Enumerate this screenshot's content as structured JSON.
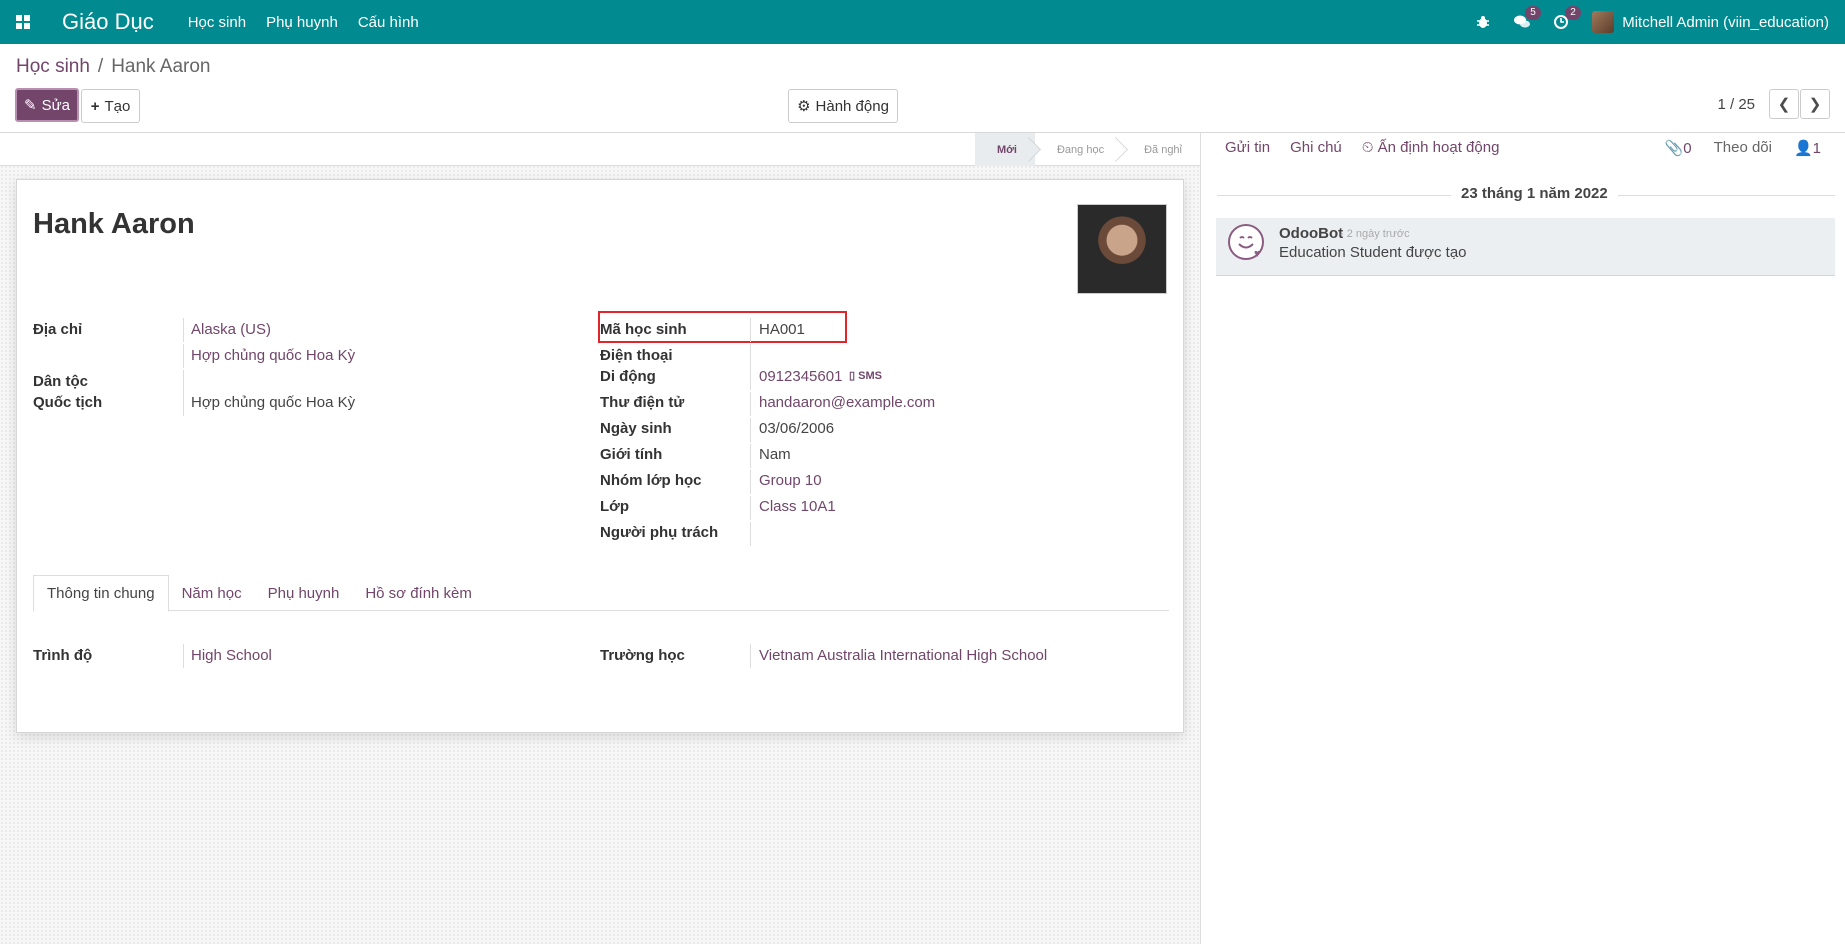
{
  "navbar": {
    "app_name": "Giáo Dục",
    "menus": [
      "Học sinh",
      "Phụ huynh",
      "Cấu hình"
    ],
    "messages_count": "5",
    "activities_count": "2",
    "user": "Mitchell Admin (viin_education)"
  },
  "breadcrumb": {
    "root": "Học sinh",
    "separator": "/",
    "current": "Hank Aaron"
  },
  "toolbar": {
    "edit_label": "Sửa",
    "create_label": "Tạo",
    "action_label": "Hành động"
  },
  "pager": {
    "value": "1 / 25"
  },
  "stages": [
    {
      "label": "Mới",
      "active": true
    },
    {
      "label": "Đang học",
      "active": false
    },
    {
      "label": "Đã nghỉ",
      "active": false
    }
  ],
  "student": {
    "name": "Hank Aaron",
    "address_label": "Địa chỉ",
    "address_state": "Alaska (US)",
    "address_country": "Hợp chủng quốc Hoa Kỳ",
    "ethnicity_label": "Dân tộc",
    "nationality_label": "Quốc tịch",
    "nationality": "Hợp chủng quốc Hoa Kỳ",
    "code_label": "Mã học sinh",
    "code": "HA001",
    "phone_label": "Điện thoại",
    "mobile_label": "Di động",
    "mobile": "0912345601",
    "sms_label": "SMS",
    "email_label": "Thư điện tử",
    "email": "handaaron@example.com",
    "birthday_label": "Ngày sinh",
    "birthday": "03/06/2006",
    "gender_label": "Giới tính",
    "gender": "Nam",
    "class_group_label": "Nhóm lớp học",
    "class_group": "Group 10",
    "class_label": "Lớp",
    "class": "Class 10A1",
    "responsible_label": "Người phụ trách"
  },
  "tabs": [
    "Thông tin chung",
    "Năm học",
    "Phụ huynh",
    "Hồ sơ đính kèm"
  ],
  "general": {
    "level_label": "Trình độ",
    "level": "High School",
    "school_label": "Trường học",
    "school": "Vietnam Australia International High School"
  },
  "chatter": {
    "send_message": "Gửi tin",
    "log_note": "Ghi chú",
    "schedule_activity": "Ấn định hoạt động",
    "attachments": "0",
    "follow": "Theo dõi",
    "followers": "1",
    "date": "23 tháng 1 năm 2022",
    "message": {
      "author": "OdooBot",
      "when": "- 2 ngày trước",
      "body": "Education Student được tạo"
    }
  },
  "colors": {
    "navbar": "#018a8f",
    "primary": "#73456b",
    "highlight": "#e0252b"
  }
}
